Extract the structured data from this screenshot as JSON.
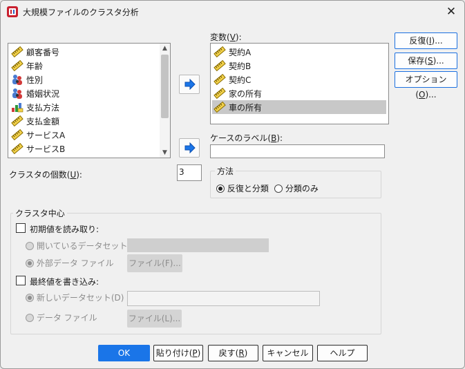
{
  "window": {
    "title": "大規模ファイルのクラスタ分析",
    "icons": {
      "app": "spss-app-icon",
      "close": "close-icon"
    }
  },
  "source_list": {
    "items": [
      {
        "label": "顧客番号",
        "icon": "ruler-scale-icon"
      },
      {
        "label": "年齢",
        "icon": "ruler-scale-icon"
      },
      {
        "label": "性別",
        "icon": "nominal-people-icon"
      },
      {
        "label": "婚姻状況",
        "icon": "nominal-people-icon"
      },
      {
        "label": "支払方法",
        "icon": "ordinal-bars-icon"
      },
      {
        "label": "支払金額",
        "icon": "ruler-scale-icon"
      },
      {
        "label": "サービスA",
        "icon": "ruler-scale-icon"
      },
      {
        "label": "サービスB",
        "icon": "ruler-scale-icon"
      }
    ]
  },
  "variables": {
    "label": "変数(",
    "mnemonic": "V",
    "suffix": "):",
    "items": [
      {
        "label": "契約A",
        "icon": "ruler-scale-icon",
        "selected": false
      },
      {
        "label": "契約B",
        "icon": "ruler-scale-icon",
        "selected": false
      },
      {
        "label": "契約C",
        "icon": "ruler-scale-icon",
        "selected": false
      },
      {
        "label": "家の所有",
        "icon": "ruler-scale-icon",
        "selected": false
      },
      {
        "label": "車の所有",
        "icon": "ruler-scale-icon",
        "selected": true
      }
    ]
  },
  "case_label": {
    "label": "ケースのラベル(",
    "mnemonic": "B",
    "suffix": "):",
    "value": ""
  },
  "side_buttons": {
    "iterate": {
      "label": "反復(",
      "mnemonic": "I",
      "suffix": ")..."
    },
    "save": {
      "label": "保存(",
      "mnemonic": "S",
      "suffix": ")..."
    },
    "options": {
      "label": "オプション(",
      "mnemonic": "O",
      "suffix": ")..."
    }
  },
  "num_clusters": {
    "label": "クラスタの個数(",
    "mnemonic": "U",
    "suffix": "):",
    "value": "3"
  },
  "method": {
    "title": "方法",
    "options": [
      {
        "label": "反復と分類",
        "selected": true
      },
      {
        "label": "分類のみ",
        "selected": false
      }
    ]
  },
  "cluster_centers": {
    "title": "クラスタ中心",
    "read_initial": {
      "label": "初期値を読み取り:",
      "checked": false,
      "open_dataset": {
        "label": "開いているデータセット",
        "selected": false
      },
      "external_file": {
        "label": "外部データ ファイル",
        "selected": true,
        "button": "ファイル(F)..."
      }
    },
    "write_final": {
      "label": "最終値を書き込み:",
      "checked": false,
      "new_dataset": {
        "label": "新しいデータセット(D)",
        "selected": true
      },
      "data_file": {
        "label": "データ ファイル",
        "selected": false,
        "button": "ファイル(L)..."
      }
    }
  },
  "footer_buttons": {
    "ok": "OK",
    "paste": {
      "label": "貼り付け(",
      "mnemonic": "P",
      "suffix": ")"
    },
    "reset": {
      "label": "戻す(",
      "mnemonic": "R",
      "suffix": ")"
    },
    "cancel": "キャンセル",
    "help": "ヘルプ"
  },
  "colors": {
    "accent": "#1a75e8",
    "selection": "#c8c8c8",
    "dialog_bg": "#f0f0f0",
    "disabled_text": "#8c8c8c"
  }
}
